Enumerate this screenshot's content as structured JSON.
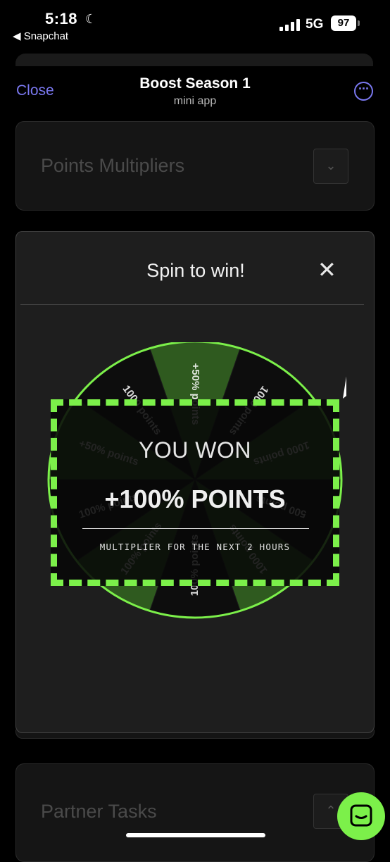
{
  "status_bar": {
    "time": "5:18",
    "back_app": "◀ Snapchat",
    "network": "5G",
    "battery": "97",
    "moon_icon": "moon-icon",
    "signal_icon": "signal-bars-icon"
  },
  "header": {
    "close_label": "Close",
    "title": "Boost Season 1",
    "subtitle": "mini app",
    "more_icon": "ellipsis-icon"
  },
  "points_multipliers": {
    "label": "Points Multipliers",
    "toggle_icon": "chevron-down-icon"
  },
  "spin_modal": {
    "title": "Spin to win!",
    "close_icon": "close-icon",
    "wheel": {
      "pointer_icon": "pointer-arrow-icon",
      "segment_labels": [
        "+50% points",
        "1000 points",
        "1000 points",
        "500 points",
        "1000 points",
        "100% points",
        "100% points",
        "100% points",
        "+50% points",
        "1000 points"
      ]
    },
    "result": {
      "heading": "YOU WON",
      "amount": "+100% POINTS",
      "detail": "MULTIPLIER FOR THE NEXT 2 HOURS"
    }
  },
  "partner_tasks": {
    "label": "Partner Tasks",
    "toggle_icon": "chevron-up-icon"
  },
  "chat_button": {
    "icon": "chat-bubble-icon"
  },
  "colors": {
    "accent": "#7a78f0",
    "wheel_green": "#7cf04a",
    "background": "#000000"
  }
}
